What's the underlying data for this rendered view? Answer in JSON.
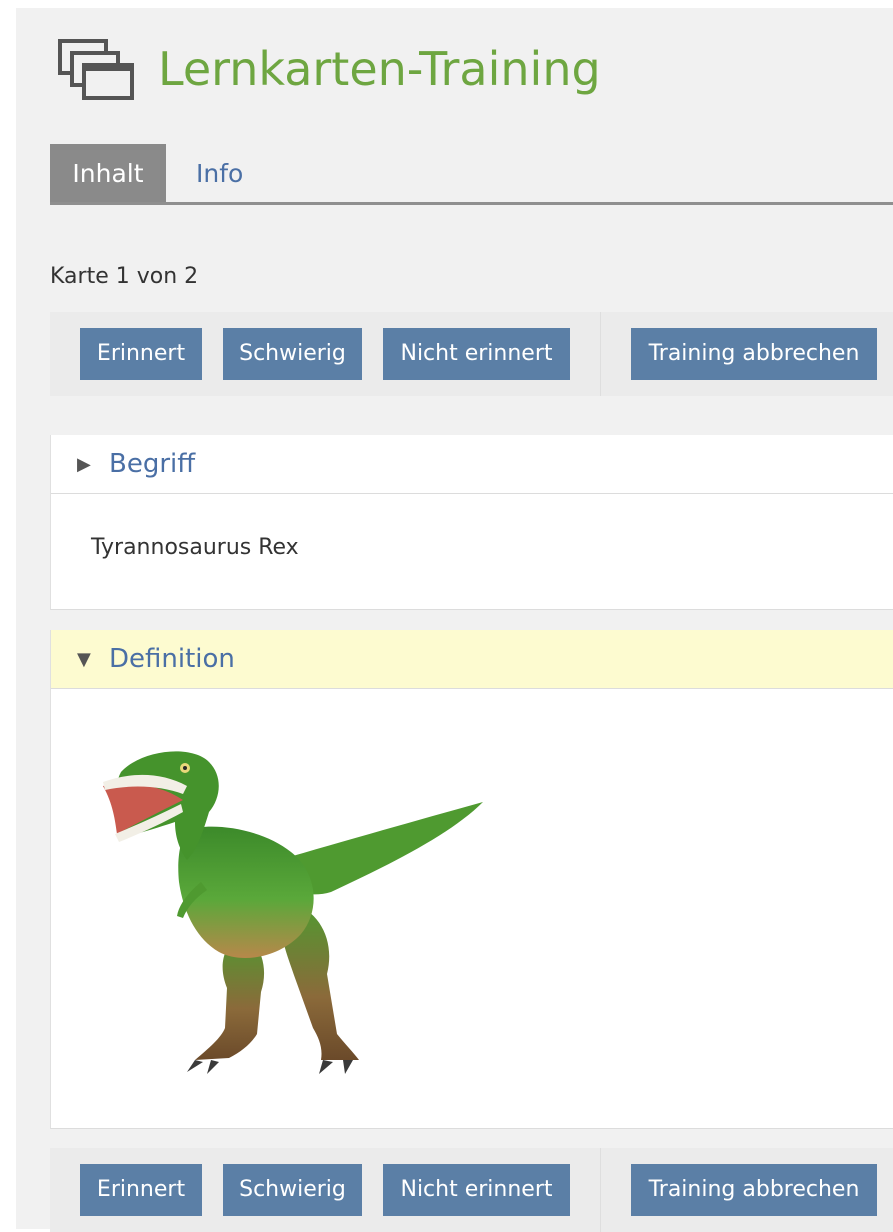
{
  "header": {
    "title": "Lernkarten-Training",
    "icon": "flashcards-stack-icon"
  },
  "tabs": [
    {
      "label": "Inhalt",
      "active": true
    },
    {
      "label": "Info",
      "active": false
    }
  ],
  "counter": "Karte 1 von 2",
  "toolbar": {
    "remembered_label": "Erinnert",
    "difficult_label": "Schwierig",
    "not_remembered_label": "Nicht erinnert",
    "abort_label": "Training abbrechen"
  },
  "term_panel": {
    "title": "Begriff",
    "expanded": false,
    "toggle_icon": "triangle-right-icon",
    "content": "Tyrannosaurus Rex"
  },
  "definition_panel": {
    "title": "Definition",
    "expanded": true,
    "toggle_icon": "triangle-down-icon",
    "image": "t-rex-image"
  },
  "colors": {
    "title_green": "#6ea641",
    "button_blue": "#5b7fa6",
    "link_blue": "#4a6fa5",
    "active_tab_gray": "#8a8a8a",
    "highlight_yellow": "#fdfbd0"
  }
}
